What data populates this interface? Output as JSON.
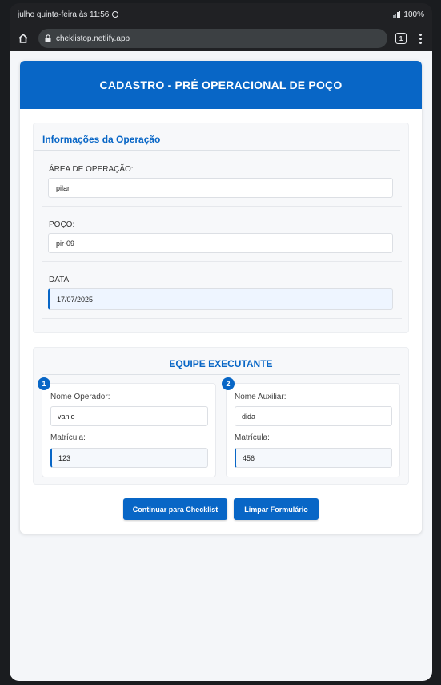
{
  "statusbar": {
    "time_text": "julho quinta-feira às 11:56",
    "battery": "100%"
  },
  "browser": {
    "url": "cheklistop.netlify.app",
    "tab_count": "1"
  },
  "page": {
    "header_title": "CADASTRO - PRÉ OPERACIONAL DE POÇO",
    "info_section": {
      "title": "Informações da Operação",
      "area_label": "ÁREA DE OPERAÇÃO:",
      "area_value": "pilar",
      "poco_label": "POÇO:",
      "poco_value": "pir-09",
      "data_label": "DATA:",
      "data_value": "17/07/2025"
    },
    "team_section": {
      "title": "EQUIPE EXECUTANTE",
      "members": [
        {
          "badge": "1",
          "name_label": "Nome Operador:",
          "name_value": "vanio",
          "mat_label": "Matrícula:",
          "mat_value": "123"
        },
        {
          "badge": "2",
          "name_label": "Nome Auxiliar:",
          "name_value": "dida",
          "mat_label": "Matrícula:",
          "mat_value": "456"
        }
      ]
    },
    "buttons": {
      "continue": "Continuar para Checklist",
      "clear": "Limpar Formulário"
    }
  },
  "colors": {
    "primary": "#0866c6",
    "page_bg": "#f4f6f9"
  }
}
